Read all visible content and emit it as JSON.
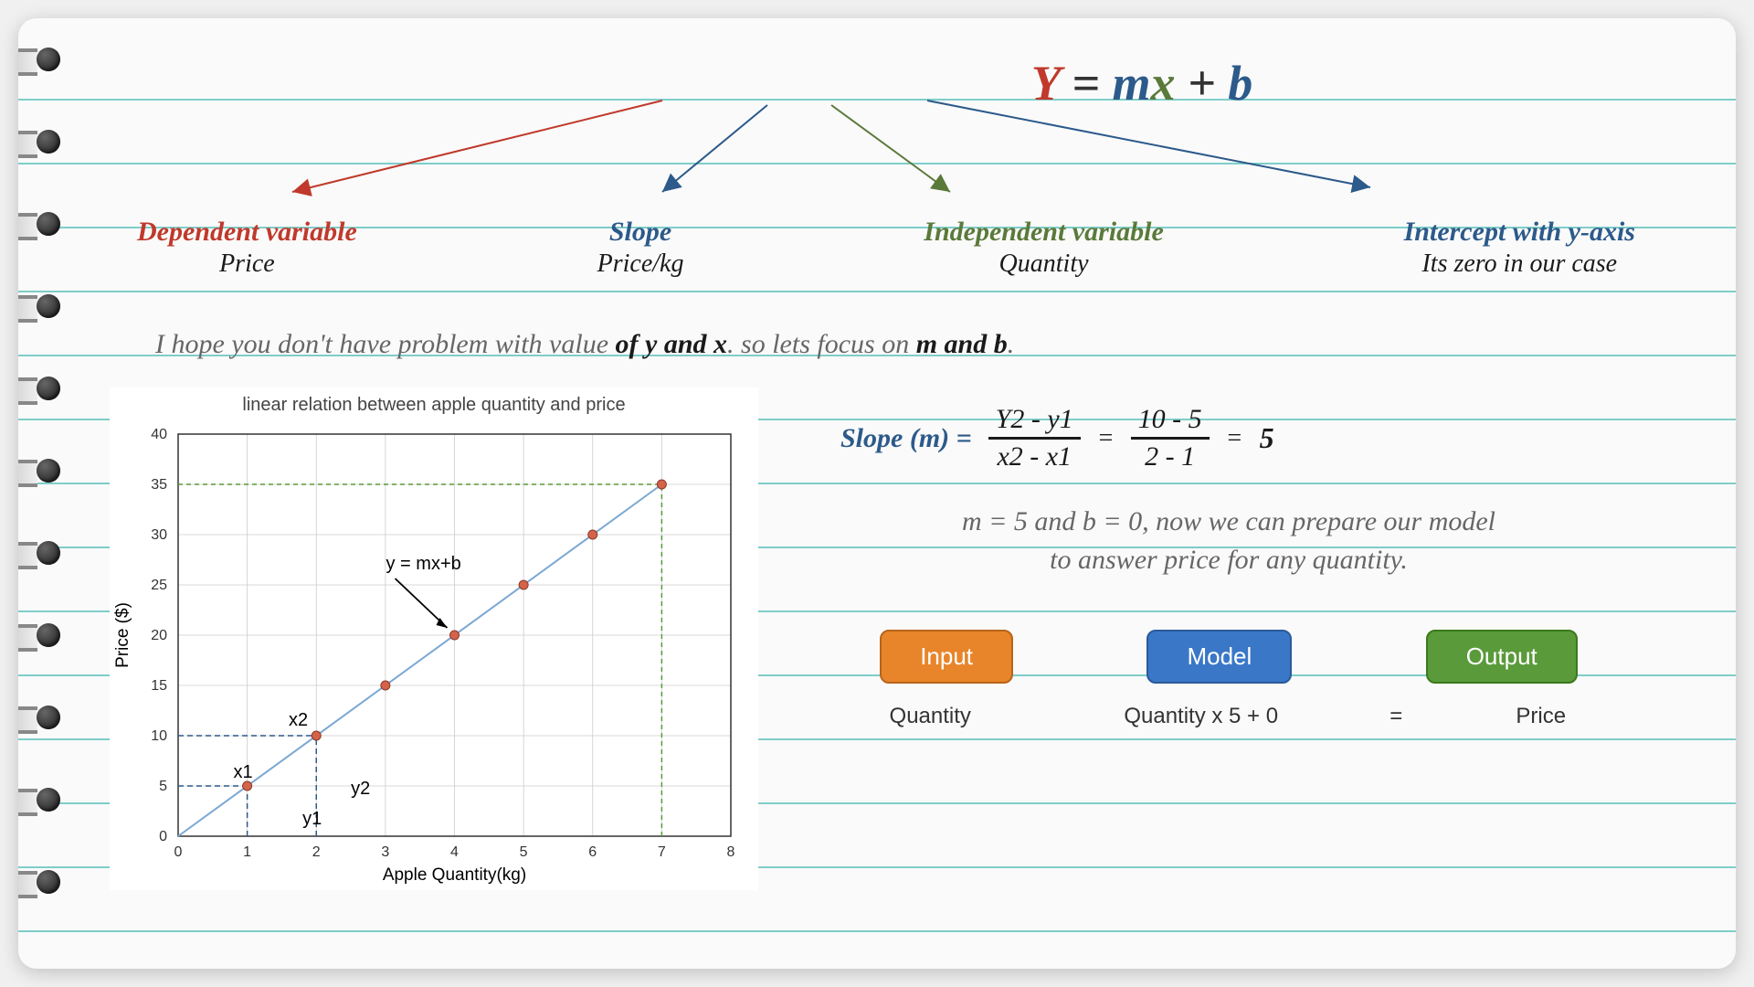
{
  "equation": {
    "y": "Y",
    "eq": "=",
    "m": "m",
    "x": "x",
    "plus": "+",
    "b": "b"
  },
  "labels": {
    "dependent": {
      "title": "Dependent variable",
      "sub": "Price"
    },
    "slope": {
      "title": "Slope",
      "sub": "Price/kg"
    },
    "independent": {
      "title": "Independent variable",
      "sub": "Quantity"
    },
    "intercept": {
      "title": "Intercept with y-axis",
      "sub": "Its zero in our case"
    }
  },
  "explain": {
    "p1": "I hope you don't have problem with value ",
    "b1": "of y and x",
    "p2": ". so lets focus on ",
    "b2": "m and b",
    "p3": "."
  },
  "slope": {
    "label": "Slope (m) =",
    "num1": "Y2 - y1",
    "den1": "x2 - x1",
    "num2": "10 - 5",
    "den2": "2 - 1",
    "result": "5"
  },
  "model_text": {
    "l1": "m = 5 and b = 0, now we can prepare our model",
    "l2": "to answer price for any quantity."
  },
  "boxes": {
    "input": "Input",
    "model": "Model",
    "output": "Output",
    "input_sub": "Quantity",
    "model_sub": "Quantity x 5 + 0",
    "eq": "=",
    "output_sub": "Price"
  },
  "chart_data": {
    "type": "line",
    "title": "linear relation between apple quantity and price",
    "xlabel": "Apple Quantity(kg)",
    "ylabel": "Price ($)",
    "x": [
      1,
      2,
      3,
      4,
      5,
      6,
      7
    ],
    "y": [
      5,
      10,
      15,
      20,
      25,
      30,
      35
    ],
    "xlim": [
      0,
      8
    ],
    "ylim": [
      0,
      40
    ],
    "xticks": [
      0,
      1,
      2,
      3,
      4,
      5,
      6,
      7,
      8
    ],
    "yticks": [
      0,
      5,
      10,
      15,
      20,
      25,
      30,
      35,
      40
    ],
    "annotations": {
      "line_label": "y = mx+b",
      "x1": "x1",
      "x2": "x2",
      "y1": "y1",
      "y2": "y2"
    },
    "marked_points": {
      "x1": 1,
      "y1": 5,
      "x2": 2,
      "y2": 10
    },
    "highlight": {
      "x": 7,
      "y": 35
    }
  }
}
